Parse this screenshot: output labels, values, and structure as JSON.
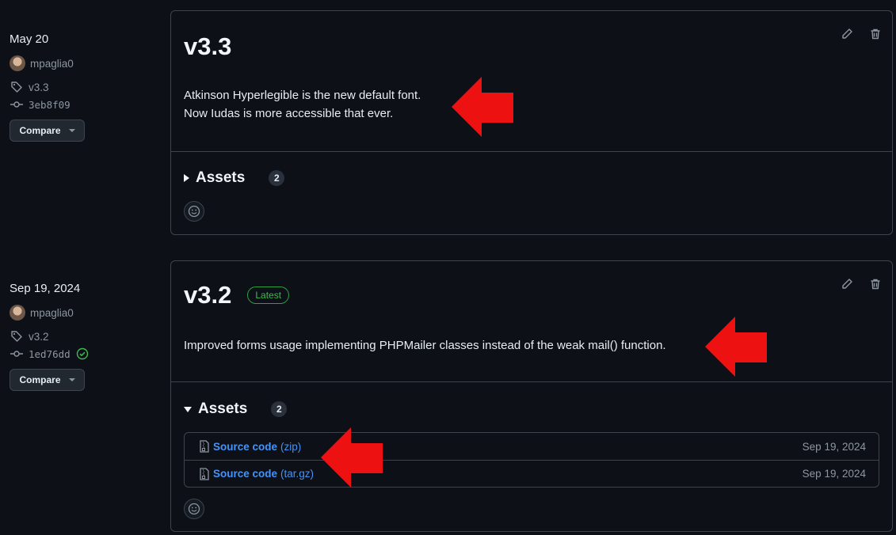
{
  "releases": [
    {
      "date": "May 20",
      "author": "mpaglia0",
      "tag": "v3.3",
      "commit": "3eb8f09",
      "compare_label": "Compare",
      "title": "v3.3",
      "description": [
        "Atkinson Hyperlegible is the new default font.",
        "Now Iudas is more accessible that ever."
      ],
      "assets_label": "Assets",
      "assets_count": "2",
      "expanded": false
    },
    {
      "date": "Sep 19, 2024",
      "author": "mpaglia0",
      "tag": "v3.2",
      "commit": "1ed76dd",
      "verified": true,
      "compare_label": "Compare",
      "title": "v3.2",
      "badge": "Latest",
      "description": [
        "Improved forms usage implementing PHPMailer classes instead of the weak mail() function."
      ],
      "assets_label": "Assets",
      "assets_count": "2",
      "expanded": true,
      "assets": [
        {
          "name": "Source code",
          "ext": "(zip)",
          "date": "Sep 19, 2024"
        },
        {
          "name": "Source code",
          "ext": "(tar.gz)",
          "date": "Sep 19, 2024"
        }
      ]
    }
  ],
  "icons": {
    "tag": "tag-icon",
    "commit": "git-commit-icon",
    "edit": "pencil-icon",
    "delete": "trash-icon",
    "emoji": "smiley-icon",
    "file": "file-zip-icon",
    "arrow": "red-arrow-annotation",
    "verified": "check-circle-icon"
  },
  "colors": {
    "background": "#0d1117",
    "border": "#3d444d",
    "link": "#4493f8",
    "latest": "#3fb950",
    "annotation_arrow": "#ee1111"
  }
}
